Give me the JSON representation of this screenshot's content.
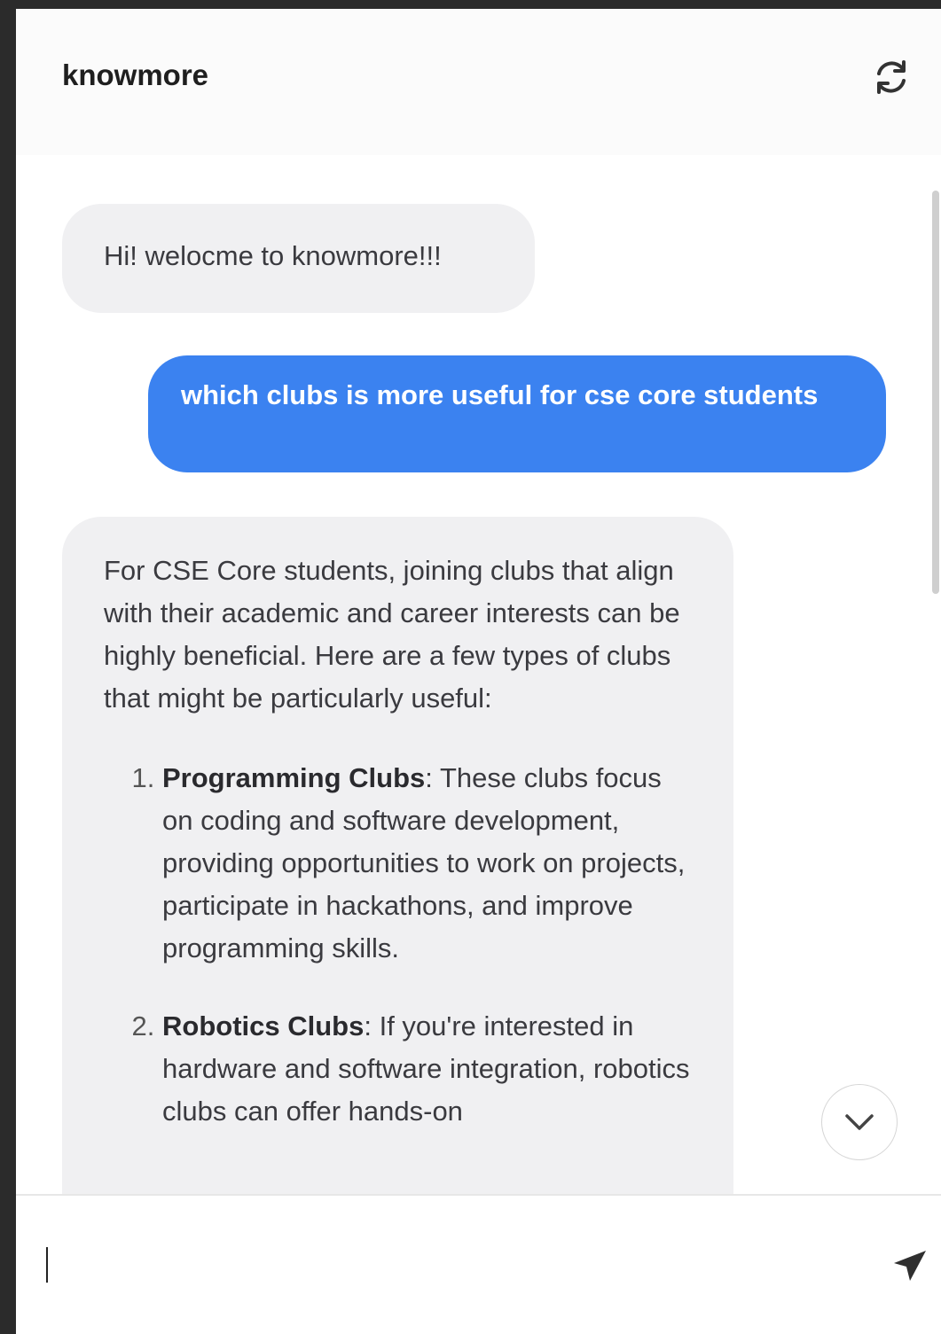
{
  "header": {
    "title": "knowmore",
    "refresh_icon": "refresh-icon"
  },
  "messages": [
    {
      "role": "bot",
      "text": "Hi! welocme to knowmore!!!"
    },
    {
      "role": "user",
      "text": "which clubs is more useful for cse core students"
    },
    {
      "role": "bot",
      "intro": "For CSE Core students, joining clubs that align with their academic and career interests can be highly beneficial. Here are a few types of clubs that might be particularly useful:",
      "list": [
        {
          "title": "Programming Clubs",
          "text": "These clubs focus on coding and software development, providing opportunities to work on projects, participate in hackathons, and improve programming skills."
        },
        {
          "title": "Robotics Clubs",
          "text": "If you're interested in hardware and software integration, robotics clubs can offer hands-on"
        }
      ]
    }
  ],
  "scroll_button_icon": "chevron-down-icon",
  "composer": {
    "value": "",
    "placeholder": "",
    "send_icon": "send-icon"
  },
  "colors": {
    "user_bubble": "#3b82f0",
    "bot_bubble": "#f0f0f2",
    "background": "#ffffff",
    "frame": "#2b2b2b"
  }
}
